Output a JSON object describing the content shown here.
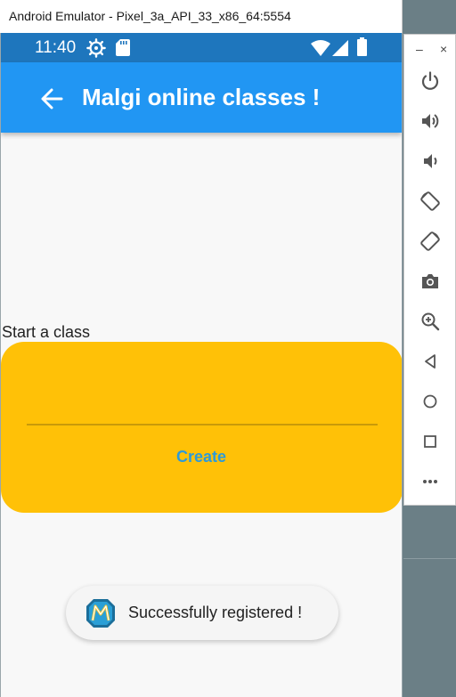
{
  "window": {
    "title": "Android Emulator - Pixel_3a_API_33_x86_64:5554"
  },
  "status_bar": {
    "time": "11:40",
    "icons": [
      "gear-icon",
      "sd-card-icon",
      "wifi-icon",
      "signal-icon",
      "battery-icon"
    ]
  },
  "app_bar": {
    "title": "Malgi online classes !",
    "back_icon": "arrow-back-icon"
  },
  "form": {
    "label": "Start a class",
    "input_value": "",
    "create_label": "Create"
  },
  "toast": {
    "message": "Successfully registered !",
    "logo": "app-logo-icon"
  },
  "side_toolbar": {
    "minimize_label": "–",
    "close_label": "×",
    "tools": [
      "power-icon",
      "volume-up-icon",
      "volume-down-icon",
      "rotate-left-icon",
      "rotate-right-icon",
      "camera-icon",
      "zoom-icon",
      "back-icon",
      "home-icon",
      "overview-icon",
      "more-icon"
    ]
  },
  "colors": {
    "status_bar": "#1e76bd",
    "app_bar": "#2196f3",
    "card": "#ffc107",
    "create_text": "#2d9ad8"
  }
}
